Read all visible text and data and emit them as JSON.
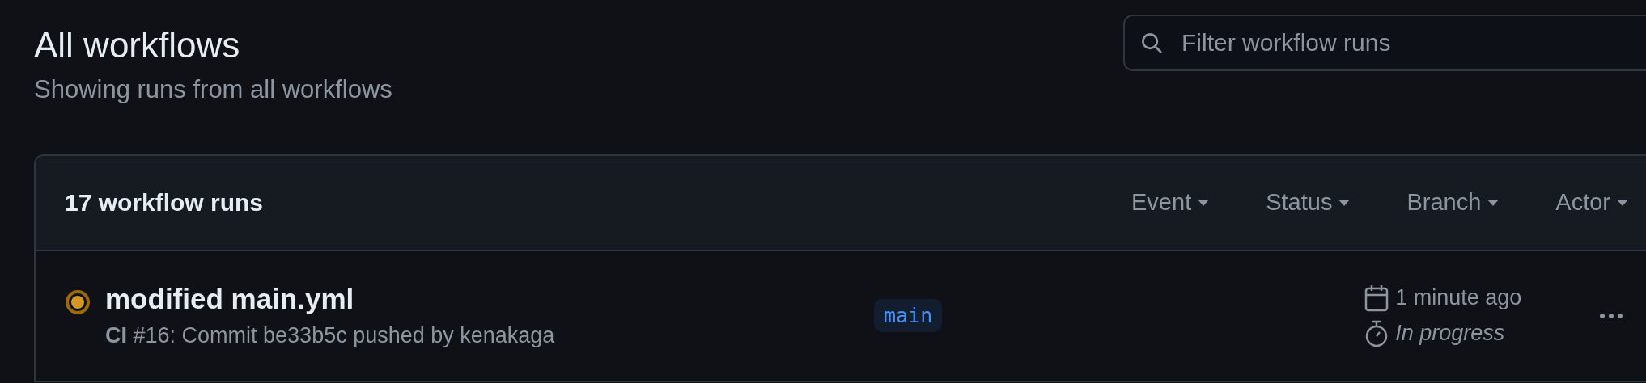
{
  "header": {
    "title": "All workflows",
    "subtitle": "Showing runs from all workflows"
  },
  "search": {
    "placeholder": "Filter workflow runs"
  },
  "runs_table": {
    "count_label": "17 workflow runs",
    "filters": [
      "Event",
      "Status",
      "Branch",
      "Actor"
    ],
    "rows": [
      {
        "in_progress": true,
        "title": "modified main.yml",
        "workflow": "CI",
        "description": "#16: Commit be33b5c pushed by kenakaga",
        "branch": "main",
        "time": "1 minute ago",
        "duration": "In progress"
      }
    ]
  }
}
